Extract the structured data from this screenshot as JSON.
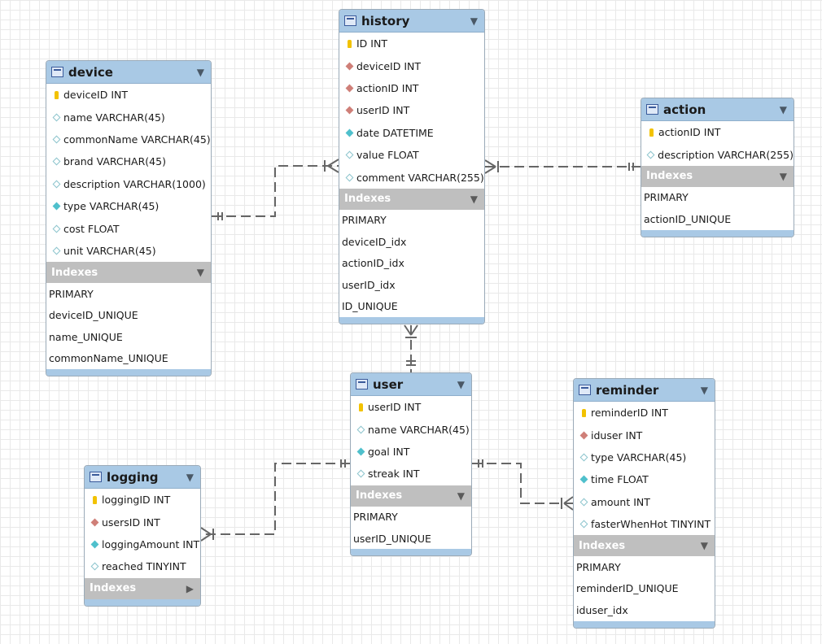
{
  "tables": {
    "device": {
      "name": "device",
      "columns": [
        {
          "text": "deviceID INT",
          "icon": "primary-key-icon"
        },
        {
          "text": "name VARCHAR(45)",
          "icon": "nullable-column-icon"
        },
        {
          "text": "commonName VARCHAR(45)",
          "icon": "nullable-column-icon"
        },
        {
          "text": "brand VARCHAR(45)",
          "icon": "nullable-column-icon"
        },
        {
          "text": "description VARCHAR(1000)",
          "icon": "nullable-column-icon"
        },
        {
          "text": "type VARCHAR(45)",
          "icon": "not-null-column-icon"
        },
        {
          "text": "cost FLOAT",
          "icon": "nullable-column-icon"
        },
        {
          "text": "unit VARCHAR(45)",
          "icon": "nullable-column-icon"
        }
      ],
      "indexes_label": "Indexes",
      "indexes": [
        "PRIMARY",
        "deviceID_UNIQUE",
        "name_UNIQUE",
        "commonName_UNIQUE"
      ]
    },
    "history": {
      "name": "history",
      "columns": [
        {
          "text": "ID INT",
          "icon": "primary-key-icon"
        },
        {
          "text": "deviceID INT",
          "icon": "foreign-key-icon"
        },
        {
          "text": "actionID INT",
          "icon": "foreign-key-icon"
        },
        {
          "text": "userID INT",
          "icon": "foreign-key-icon"
        },
        {
          "text": "date DATETIME",
          "icon": "not-null-column-icon"
        },
        {
          "text": "value FLOAT",
          "icon": "nullable-column-icon"
        },
        {
          "text": "comment VARCHAR(255)",
          "icon": "nullable-column-icon"
        }
      ],
      "indexes_label": "Indexes",
      "indexes": [
        "PRIMARY",
        "deviceID_idx",
        "actionID_idx",
        "userID_idx",
        "ID_UNIQUE"
      ]
    },
    "action": {
      "name": "action",
      "columns": [
        {
          "text": "actionID INT",
          "icon": "primary-key-icon"
        },
        {
          "text": "description VARCHAR(255)",
          "icon": "nullable-column-icon"
        }
      ],
      "indexes_label": "Indexes",
      "indexes": [
        "PRIMARY",
        "actionID_UNIQUE"
      ]
    },
    "user": {
      "name": "user",
      "columns": [
        {
          "text": "userID INT",
          "icon": "primary-key-icon"
        },
        {
          "text": "name VARCHAR(45)",
          "icon": "nullable-column-icon"
        },
        {
          "text": "goal INT",
          "icon": "not-null-column-icon"
        },
        {
          "text": "streak INT",
          "icon": "nullable-column-icon"
        }
      ],
      "indexes_label": "Indexes",
      "indexes": [
        "PRIMARY",
        "userID_UNIQUE"
      ]
    },
    "reminder": {
      "name": "reminder",
      "columns": [
        {
          "text": "reminderID INT",
          "icon": "primary-key-icon"
        },
        {
          "text": "iduser INT",
          "icon": "foreign-key-icon"
        },
        {
          "text": "type VARCHAR(45)",
          "icon": "nullable-column-icon"
        },
        {
          "text": "time FLOAT",
          "icon": "not-null-column-icon"
        },
        {
          "text": "amount INT",
          "icon": "nullable-column-icon"
        },
        {
          "text": "fasterWhenHot TINYINT",
          "icon": "nullable-column-icon"
        }
      ],
      "indexes_label": "Indexes",
      "indexes": [
        "PRIMARY",
        "reminderID_UNIQUE",
        "iduser_idx"
      ]
    },
    "logging": {
      "name": "logging",
      "columns": [
        {
          "text": "loggingID INT",
          "icon": "primary-key-icon"
        },
        {
          "text": "usersID INT",
          "icon": "foreign-key-icon"
        },
        {
          "text": "loggingAmount INT",
          "icon": "not-null-column-icon"
        },
        {
          "text": "reached TINYINT",
          "icon": "nullable-column-icon"
        }
      ],
      "indexes_label": "Indexes",
      "indexes_collapsed": true,
      "indexes": []
    }
  },
  "relationships": [
    {
      "from": "device",
      "to": "history",
      "type": "one-to-many"
    },
    {
      "from": "action",
      "to": "history",
      "type": "one-to-many"
    },
    {
      "from": "user",
      "to": "history",
      "type": "one-to-many"
    },
    {
      "from": "user",
      "to": "logging",
      "type": "one-to-many"
    },
    {
      "from": "user",
      "to": "reminder",
      "type": "one-to-many"
    }
  ],
  "colors": {
    "header": "#a9c9e5",
    "indexes_header": "#bfbfbf",
    "primary_key": "#f2c200",
    "foreign_key": "#cf7f78",
    "not_null": "#4fc0cc",
    "connector": "#666666"
  }
}
